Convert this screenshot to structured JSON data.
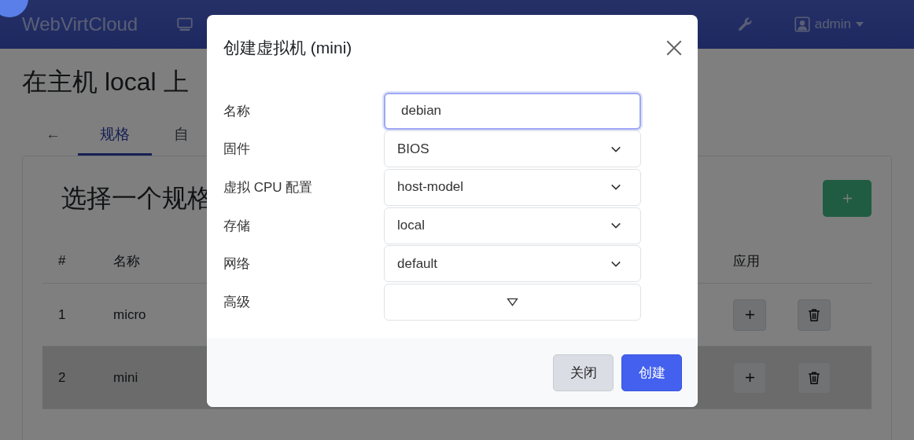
{
  "navbar": {
    "brand": "WebVirtCloud",
    "user": "admin"
  },
  "page": {
    "title": "在主机 local 上",
    "tabs": [
      {
        "kind": "back",
        "label": "←",
        "selected": false
      },
      {
        "kind": "tab",
        "label": "规格",
        "selected": true
      },
      {
        "kind": "tab",
        "label": "自",
        "selected": false
      }
    ],
    "card": {
      "heading": "选择一个规格",
      "columns": [
        "#",
        "名称",
        "应用"
      ],
      "rows": [
        {
          "number": "1",
          "name": "micro",
          "highlighted": false
        },
        {
          "number": "2",
          "name": "mini",
          "highlighted": true
        }
      ]
    }
  },
  "modal": {
    "title": "创建虚拟机 (mini)",
    "fields": [
      {
        "label": "名称",
        "kind": "input",
        "value": "debian"
      },
      {
        "label": "固件",
        "kind": "select",
        "value": "BIOS"
      },
      {
        "label": "虚拟 CPU 配置",
        "kind": "select",
        "value": "host-model"
      },
      {
        "label": "存储",
        "kind": "select",
        "value": "local"
      },
      {
        "label": "网络",
        "kind": "select",
        "value": "default"
      },
      {
        "label": "高级",
        "kind": "toggle"
      }
    ],
    "buttons": [
      {
        "label": "关闭",
        "kind": "secondary"
      },
      {
        "label": "创建",
        "kind": "primary"
      }
    ]
  }
}
